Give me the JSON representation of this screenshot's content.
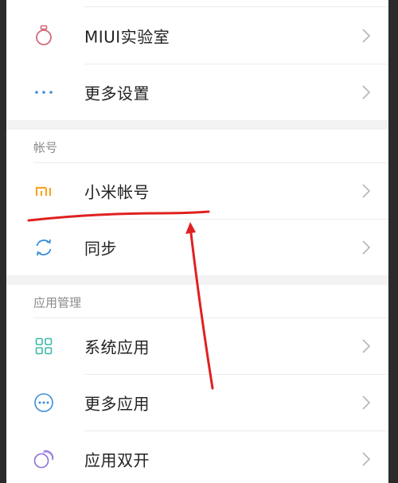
{
  "settings": {
    "rows": [
      {
        "label": "MIUI实验室",
        "icon": "flask-icon"
      },
      {
        "label": "更多设置",
        "icon": "more-dots-icon"
      }
    ],
    "account_section": {
      "header": "帐号",
      "rows": [
        {
          "label": "小米帐号",
          "icon": "mi-logo-icon"
        },
        {
          "label": "同步",
          "icon": "sync-icon"
        }
      ]
    },
    "apps_section": {
      "header": "应用管理",
      "rows": [
        {
          "label": "系统应用",
          "icon": "grid-icon"
        },
        {
          "label": "更多应用",
          "icon": "more-circle-icon"
        },
        {
          "label": "应用双开",
          "icon": "dual-app-icon"
        }
      ]
    }
  },
  "colors": {
    "mi_orange": "#f5a623",
    "sync_blue": "#3a8fd8",
    "grid_teal": "#3bb8a6",
    "more_blue": "#3a8fd8",
    "dual_purple": "#8a6fd8",
    "flask_pink": "#d06a7a",
    "annotation_red": "#e02020"
  }
}
